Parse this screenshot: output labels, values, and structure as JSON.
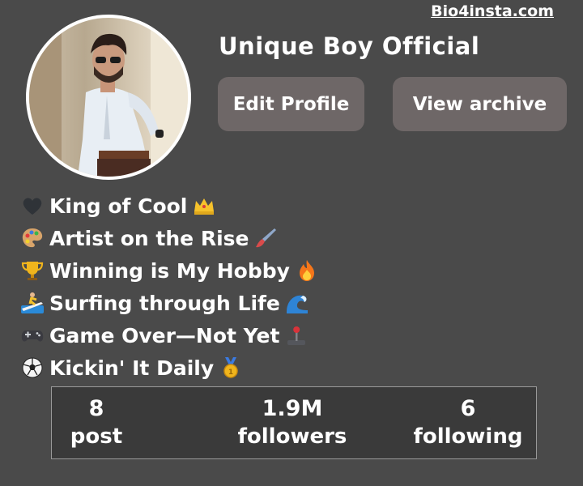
{
  "watermark": "Bio4insta.com",
  "profile": {
    "username": "Unique Boy Official",
    "edit_profile_label": "Edit Profile",
    "view_archive_label": "View archive"
  },
  "bio": [
    {
      "lead_icon": "black-heart-icon",
      "text": "King of Cool",
      "trail_icon": "crown-icon"
    },
    {
      "lead_icon": "artist-palette-icon",
      "text": "Artist on the Rise",
      "trail_icon": "paintbrush-icon"
    },
    {
      "lead_icon": "trophy-icon",
      "text": "Winning is My Hobby",
      "trail_icon": "fire-icon"
    },
    {
      "lead_icon": "surfer-icon",
      "text": "Surfing through Life",
      "trail_icon": "wave-icon"
    },
    {
      "lead_icon": "game-controller-icon",
      "text": "Game Over—Not Yet",
      "trail_icon": "joystick-icon"
    },
    {
      "lead_icon": "soccer-ball-icon",
      "text": "Kickin' It Daily",
      "trail_icon": "medal-icon"
    }
  ],
  "stats": {
    "posts_count": "8",
    "posts_label": "post",
    "followers_count": "1.9M",
    "followers_label": "followers",
    "following_count": "6",
    "following_label": "following"
  },
  "colors": {
    "background": "#4a4a4a",
    "button_bg": "#6e6767",
    "stats_bg": "#3a3a3a",
    "text": "#ffffff"
  }
}
